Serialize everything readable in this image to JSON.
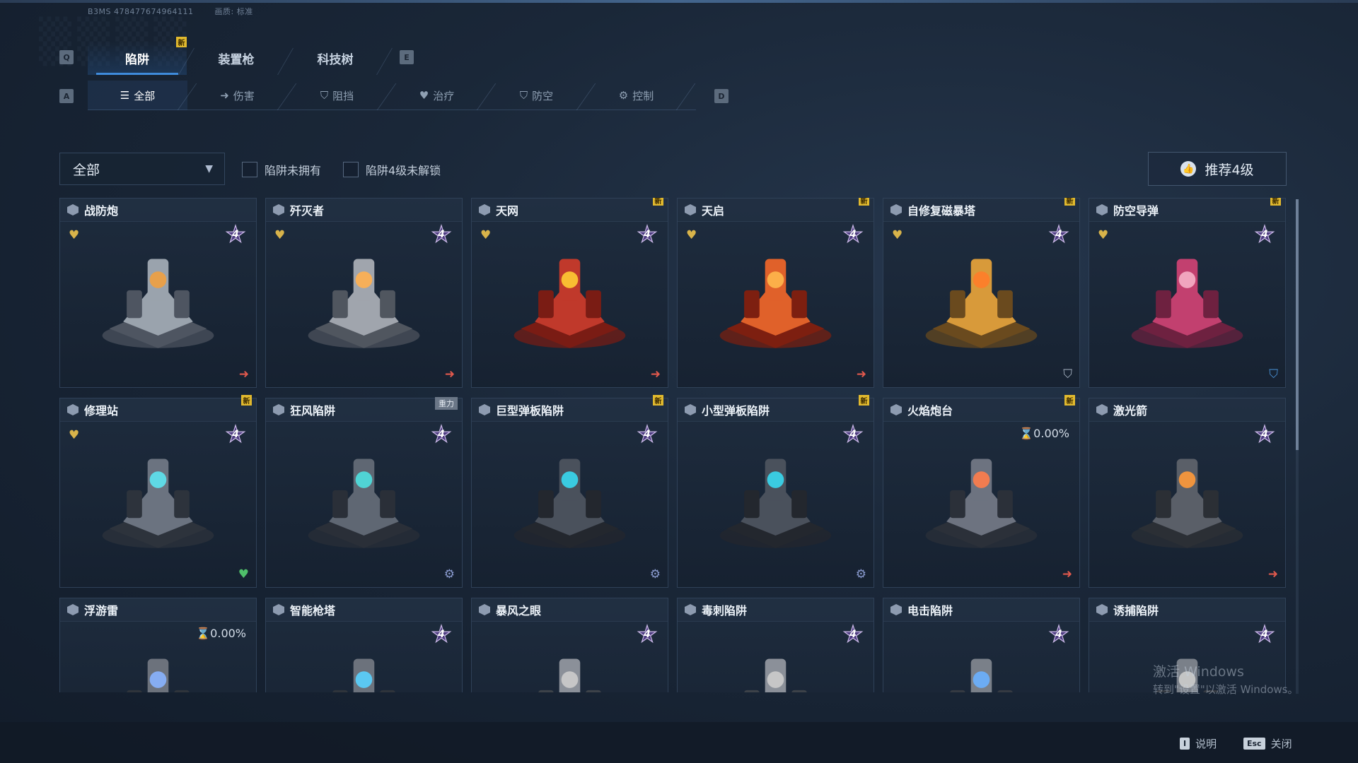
{
  "header": {
    "id_text": "B3MS 478477674964111",
    "quality_text": "画质: 标准",
    "key_left": "Q",
    "key_right": "E",
    "sub_key_left": "A",
    "sub_key_right": "D"
  },
  "main_tabs": [
    {
      "label": "陷阱",
      "active": true,
      "new": "新"
    },
    {
      "label": "装置枪",
      "active": false
    },
    {
      "label": "科技树",
      "active": false
    }
  ],
  "sub_tabs": [
    {
      "label": "全部",
      "icon": "list-icon",
      "glyph": "☰",
      "active": true
    },
    {
      "label": "伤害",
      "icon": "arrow-right-icon",
      "glyph": "➜"
    },
    {
      "label": "阻挡",
      "icon": "shield-icon",
      "glyph": "⛉"
    },
    {
      "label": "治疗",
      "icon": "heart-icon",
      "glyph": "♥"
    },
    {
      "label": "防空",
      "icon": "air-defense-icon",
      "glyph": "⛉"
    },
    {
      "label": "控制",
      "icon": "gear-icon",
      "glyph": "⚙"
    }
  ],
  "filter": {
    "dropdown_value": "全部",
    "checkbox_not_owned": "陷阱未拥有",
    "checkbox_lv4_locked": "陷阱4级未解锁",
    "recommend_label": "推荐4级"
  },
  "cards": [
    {
      "name": "战防炮",
      "level": "4",
      "favorite": true,
      "type": "damage"
    },
    {
      "name": "歼灭者",
      "level": "4",
      "favorite": true,
      "type": "damage"
    },
    {
      "name": "天网",
      "level": "4",
      "favorite": true,
      "type": "damage",
      "new": "新"
    },
    {
      "name": "天启",
      "level": "4",
      "favorite": true,
      "type": "damage",
      "new": "新"
    },
    {
      "name": "自修复磁暴塔",
      "level": "4",
      "favorite": true,
      "type": "block",
      "new": "新"
    },
    {
      "name": "防空导弹",
      "level": "4",
      "favorite": true,
      "type": "air",
      "new": "新"
    },
    {
      "name": "修理站",
      "level": "4",
      "favorite": true,
      "type": "heal",
      "new": "新"
    },
    {
      "name": "狂风陷阱",
      "level": "4",
      "type": "control",
      "tag": "重力"
    },
    {
      "name": "巨型弹板陷阱",
      "level": "4",
      "type": "control",
      "new": "新"
    },
    {
      "name": "小型弹板陷阱",
      "level": "4",
      "type": "control",
      "new": "新"
    },
    {
      "name": "火焰炮台",
      "progress": "0.00%",
      "type": "damage",
      "new": "新"
    },
    {
      "name": "激光箭",
      "level": "4",
      "type": "damage"
    },
    {
      "name": "浮游雷",
      "progress": "0.00%"
    },
    {
      "name": "智能枪塔",
      "level": "4"
    },
    {
      "name": "暴风之眼",
      "level": "4"
    },
    {
      "name": "毒刺陷阱",
      "level": "4"
    },
    {
      "name": "电击陷阱",
      "level": "4"
    },
    {
      "name": "诱捕陷阱",
      "level": "4"
    }
  ],
  "footer": {
    "help_key": "I",
    "help_label": "说明",
    "close_key": "Esc",
    "close_label": "关闭"
  },
  "watermark": {
    "line1": "激活 Windows",
    "line2": "转到\"设置\"以激活 Windows。"
  },
  "colors": {
    "accent": "#3f8bdb",
    "new_badge": "#e1b92e",
    "favorite": "#d8b34a",
    "damage": "#e2594d",
    "heal": "#4fbf6a",
    "air": "#4a93d8"
  }
}
